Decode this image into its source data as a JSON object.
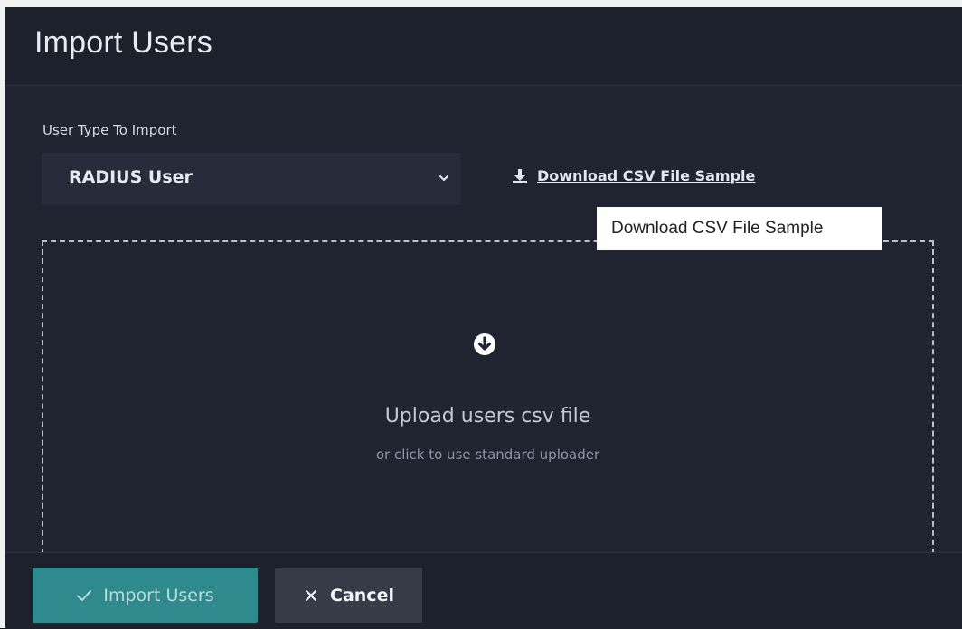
{
  "modal": {
    "title": "Import Users"
  },
  "form": {
    "user_type_label": "User Type To Import",
    "user_type_value": "RADIUS User",
    "download_link_text": "Download CSV File Sample",
    "tooltip_text": "Download CSV File Sample"
  },
  "dropzone": {
    "title": "Upload users csv file",
    "subtitle": "or click to use standard uploader"
  },
  "footer": {
    "import_button_label": "Import Users",
    "cancel_button_label": "Cancel"
  },
  "colors": {
    "primary_button": "#2f8a8d",
    "modal_bg": "#1f2430"
  },
  "icons": {
    "chevron": "chevron-down-icon",
    "download": "download-icon",
    "dropzone": "arrow-circle-down-icon",
    "check": "check-icon",
    "close": "close-icon"
  }
}
